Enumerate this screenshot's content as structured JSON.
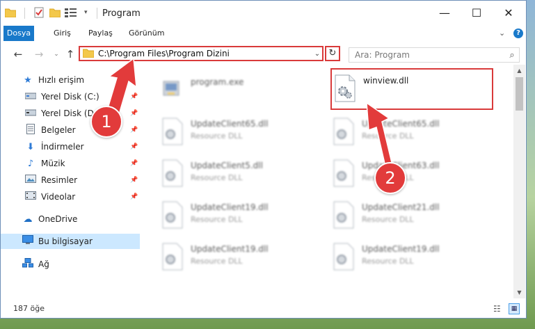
{
  "window": {
    "title": "Program",
    "controls": {
      "minimize": "—",
      "maximize": "☐",
      "close": "✕"
    }
  },
  "ribbon": {
    "tabs": [
      {
        "label": "Dosya"
      },
      {
        "label": "Giriş"
      },
      {
        "label": "Paylaş"
      },
      {
        "label": "Görünüm"
      }
    ],
    "help": "?",
    "expand": "⌄"
  },
  "navigation": {
    "back": "←",
    "forward": "→",
    "recent": "⌄",
    "up": "↑",
    "address": "C:\\Program Files\\Program Dizini",
    "search_placeholder": "Ara: Program"
  },
  "sidebar": {
    "items": [
      {
        "label": "Hızlı erişim",
        "icon": "star-icon",
        "glyph": "★",
        "pinned": false
      },
      {
        "label": "Yerel Disk (C:)",
        "icon": "drive-icon",
        "glyph": "▬",
        "pinned": true
      },
      {
        "label": "Yerel Disk (D:)",
        "icon": "drive-icon",
        "glyph": "▬",
        "pinned": true
      },
      {
        "label": "Belgeler",
        "icon": "documents-icon",
        "glyph": "▤",
        "pinned": true
      },
      {
        "label": "İndirmeler",
        "icon": "downloads-icon",
        "glyph": "⬇",
        "pinned": true
      },
      {
        "label": "Müzik",
        "icon": "music-icon",
        "glyph": "♪",
        "pinned": true
      },
      {
        "label": "Resimler",
        "icon": "pictures-icon",
        "glyph": "▣",
        "pinned": true
      },
      {
        "label": "Videolar",
        "icon": "videos-icon",
        "glyph": "▦",
        "pinned": true
      },
      {
        "label": "OneDrive",
        "icon": "cloud-icon",
        "glyph": "☁",
        "pinned": false
      },
      {
        "label": "Bu bilgisayar",
        "icon": "computer-icon",
        "glyph": "▭",
        "pinned": false,
        "selected": true
      },
      {
        "label": "Ağ",
        "icon": "network-icon",
        "glyph": "⊞",
        "pinned": false
      }
    ],
    "pin_glyph": "📌"
  },
  "files": [
    {
      "name": "program.exe",
      "type": "",
      "blurred": true
    },
    {
      "name": "winview.dll",
      "type": "",
      "blurred": false
    },
    {
      "name": "UpdateClient65.dll",
      "type": "Resource DLL",
      "blurred": true
    },
    {
      "name": "UpdateClient65.dll",
      "type": "Resource DLL",
      "blurred": true
    },
    {
      "name": "UpdateClient5.dll",
      "type": "Resource DLL",
      "blurred": true
    },
    {
      "name": "UpdateClient63.dll",
      "type": "Resource DLL",
      "blurred": true
    },
    {
      "name": "UpdateClient19.dll",
      "type": "Resource DLL",
      "blurred": true
    },
    {
      "name": "UpdateClient21.dll",
      "type": "Resource DLL",
      "blurred": true
    },
    {
      "name": "UpdateClient19.dll",
      "type": "Resource DLL",
      "blurred": true
    },
    {
      "name": "UpdateClient19.dll",
      "type": "Resource DLL",
      "blurred": true
    }
  ],
  "status": {
    "item_count": "187 öğe"
  },
  "annotations": {
    "step1": "1",
    "step2": "2",
    "color": "#e23b3b"
  }
}
